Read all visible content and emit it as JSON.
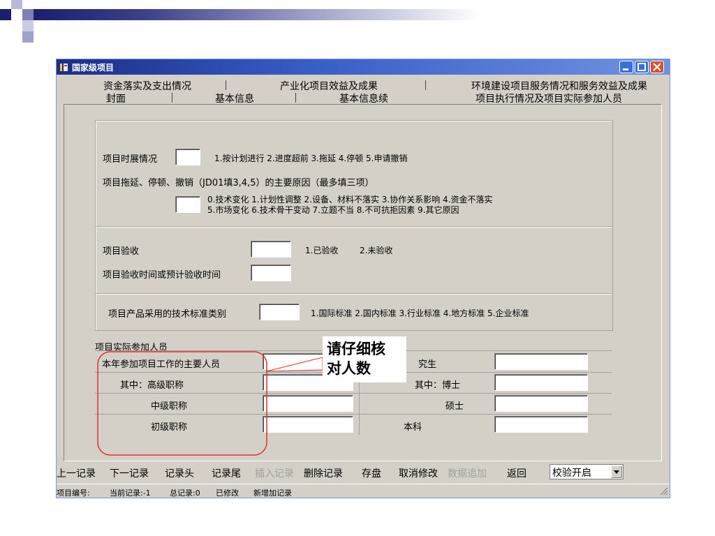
{
  "window": {
    "title": "国家级项目"
  },
  "tabs_row1": [
    "资金落实及支出情况",
    "产业化项目效益及成果",
    "环境建设项目服务情况和服务效益及成果"
  ],
  "tabs_row2": [
    "封面",
    "基本信息",
    "基本信息续",
    "项目执行情况及项目实际参加人员"
  ],
  "progress": {
    "label": "项目时展情况",
    "options": "1.按计划进行 2.进度超前 3.拖延 4.停顿 5.申请撤销",
    "reason_label": "项目拖延、停顿、撤销（JD01填3,4,5）的主要原因（最多填三项）",
    "reason_options_line1": "0.技术变化 1.计划性调整 2.设备、材料不落实 3.协作关系影响 4.资金不落实",
    "reason_options_line2": "5.市场变化 6.技术骨干变动 7.立题不当 8.不可抗拒因素 9.其它原因"
  },
  "acceptance": {
    "label": "项目验收",
    "options_1": "1.已验收",
    "options_2": "2.未验收",
    "time_label": "项目验收时间或预计验收时间"
  },
  "standard": {
    "label": "项目产品采用的技术标准类别",
    "options": "1.国际标准 2.国内标准 3.行业标准 4.地方标准 5.企业标准"
  },
  "staff": {
    "section_label": "项目实际参加人员",
    "main_label": "本年参加项目工作的主要人员",
    "senior_label": "其中：高级职称",
    "middle_label": "中级职称",
    "junior_label": "初级职称",
    "grad_label": "究生",
    "phd_label": "其中：博士",
    "master_label": "硕士",
    "bachelor_label": "本科"
  },
  "callout": {
    "line1": "请仔细核",
    "line2": "对人数"
  },
  "bottom_buttons": [
    "上一记录",
    "下一记录",
    "记录头",
    "记录尾",
    "插入记录",
    "删除记录",
    "存盘",
    "取消修改",
    "数据追加",
    "返回"
  ],
  "select_value": "校验开启",
  "status": {
    "code": "项目编号:",
    "current": "当前记录:-1",
    "total": "总记录:0",
    "modified": "已修改",
    "new_record": "新增加记录"
  },
  "colors": {
    "title_bar": "#365cc8",
    "window_bg": "#d4d0c8",
    "callout_border": "#e0302a",
    "disabled_text": "#a0a0a0"
  }
}
